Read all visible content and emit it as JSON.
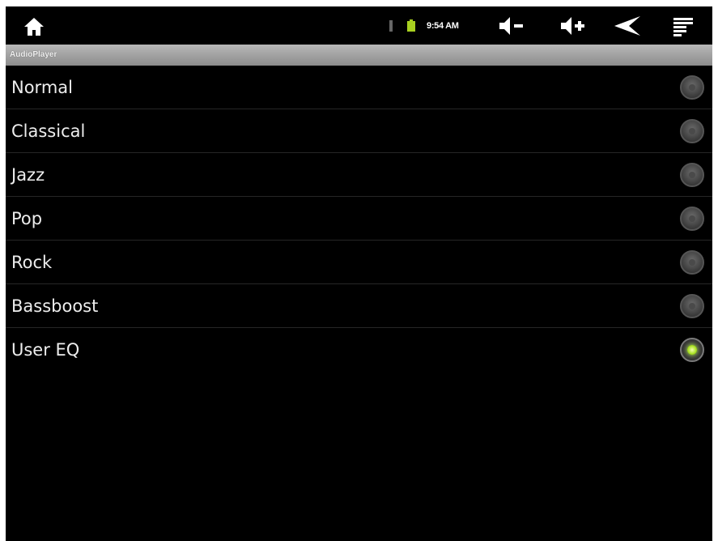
{
  "status_bar": {
    "time": "9:54 AM",
    "icons": [
      "home-icon",
      "usb-icon",
      "battery-icon",
      "volume-down-icon",
      "volume-up-icon",
      "back-icon",
      "menu-icon"
    ],
    "battery_color": "#a8d020"
  },
  "app": {
    "title": "AudioPlayer"
  },
  "eq_presets": [
    {
      "label": "Normal",
      "selected": false
    },
    {
      "label": "Classical",
      "selected": false
    },
    {
      "label": "Jazz",
      "selected": false
    },
    {
      "label": "Pop",
      "selected": false
    },
    {
      "label": "Rock",
      "selected": false
    },
    {
      "label": "Bassboost",
      "selected": false
    },
    {
      "label": "User EQ",
      "selected": true
    }
  ],
  "colors": {
    "background": "#000000",
    "title_bar": "#a8a8a8",
    "text": "#ededed",
    "selected_indicator": "#a8e020"
  }
}
